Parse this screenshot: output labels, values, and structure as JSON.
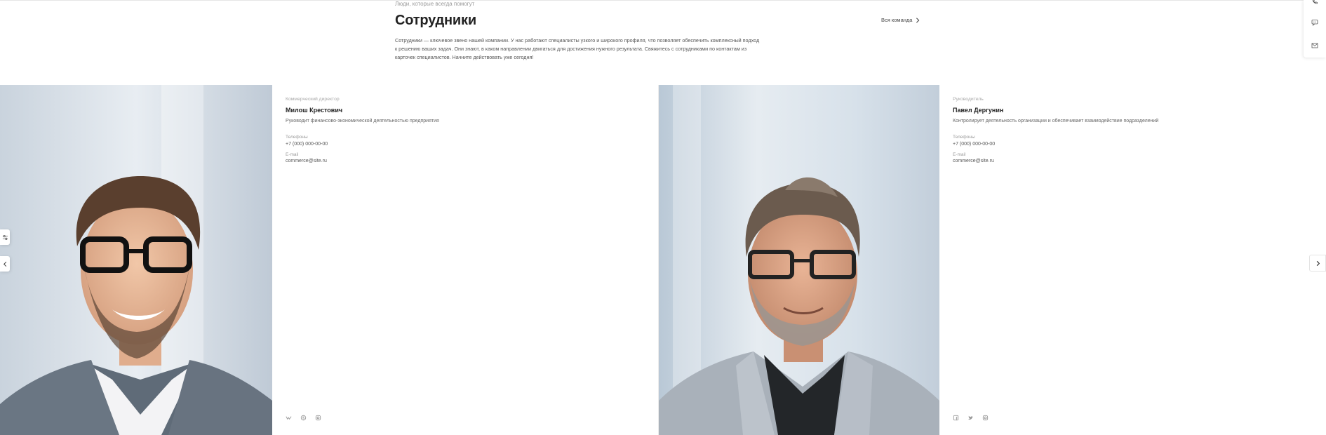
{
  "section": {
    "eyebrow": "Люди, которые всегда помогут",
    "title": "Сотрудники",
    "description": "Сотрудники — ключевое звено нашей компании. У нас работают специалисты узкого и широкого профиля, что позволяет обеспечить комплексный подход к решению ваших задач. Они знают, в каком направлении двигаться для достижения нужного результата. Свяжитесь с сотрудниками по контактам из карточек специалистов. Начните действовать уже сегодня!",
    "all_team_label": "Вся команда"
  },
  "employees": [
    {
      "role": "Коммерческий директор",
      "name": "Милош Крестович",
      "about": "Руководит финансово-экономической деятельностью предприятия",
      "phone_label": "Телефоны",
      "phone": "+7 (000) 000-00-00",
      "email_label": "E-mail",
      "email": "commerce@site.ru",
      "socials": [
        "vk-icon",
        "skype-icon",
        "instagram-icon"
      ]
    },
    {
      "role": "Руководитель",
      "name": "Павел Дергунин",
      "about": "Контролирует деятельность организации и обеспечивает взаимодействие подразделений",
      "phone_label": "Телефоны",
      "phone": "+7 (000) 000-00-00",
      "email_label": "E-mail",
      "email": "commerce@site.ru",
      "socials": [
        "facebook-icon",
        "twitter-icon",
        "instagram-icon"
      ]
    }
  ],
  "tools": [
    "phone-icon",
    "chat-icon",
    "mail-icon"
  ],
  "colors": {
    "accent": "#222222",
    "muted": "#9a9a9a",
    "border": "#e6e6e6"
  }
}
